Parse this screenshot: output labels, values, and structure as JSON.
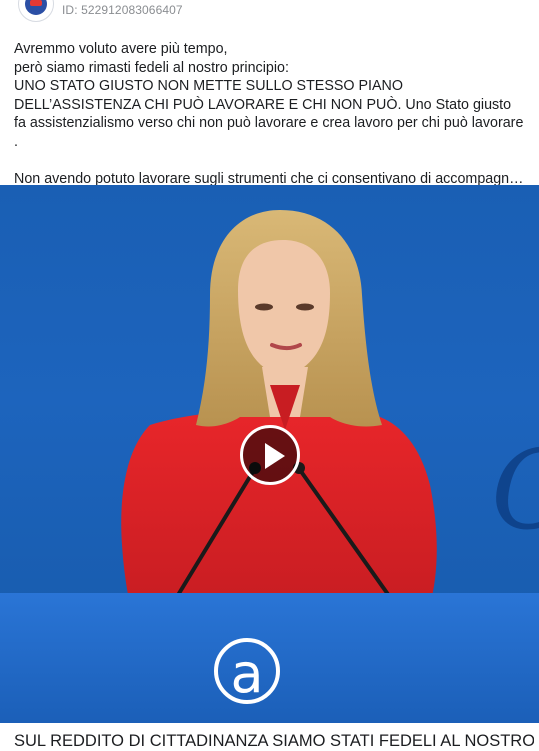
{
  "post": {
    "id_label": "ID: 522912083066407",
    "text": {
      "line1": "Avremmo voluto avere più tempo,\nperò siamo rimasti fedeli al nostro principio:\nUNO STATO GIUSTO NON METTE SULLO STESSO PIANO DELL’ASSISTENZA CHI PUÒ LAVORARE E CHI NON PUÒ. Uno Stato giusto fa assistenzialismo verso chi non può lavorare e crea lavoro per chi può lavorare .",
      "line2": "Non avendo potuto lavorare sugli strumenti che ci consentivano di accompagnar…"
    }
  },
  "media": {
    "caption": "SUL REDDITO DI CITTADINANZA SIAMO STATI FEDELI AL NOSTRO",
    "background_color": "#1b5fb8",
    "icon_play": "play-icon"
  },
  "colors": {
    "text": "#1c1e21",
    "muted": "#8a8d91",
    "accent": "#1b5fb8"
  }
}
